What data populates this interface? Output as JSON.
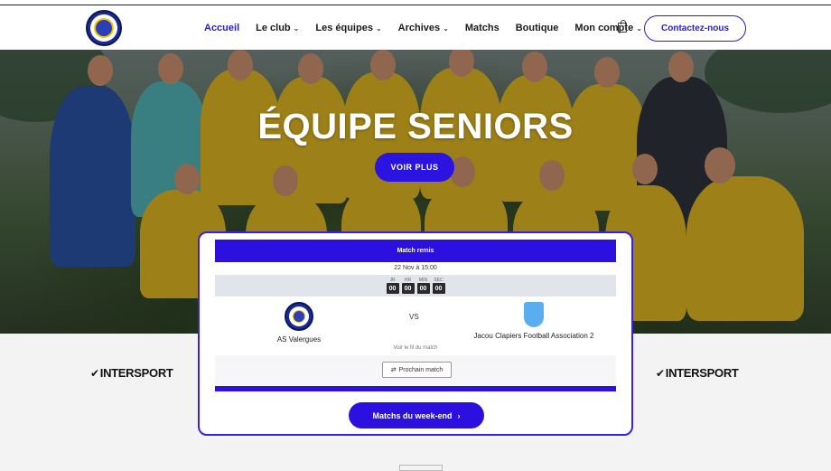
{
  "header": {
    "logo_name": "club-crest-logo",
    "nav": [
      {
        "label": "Accueil",
        "active": true,
        "dropdown": false
      },
      {
        "label": "Le club",
        "active": false,
        "dropdown": true
      },
      {
        "label": "Les équipes",
        "active": false,
        "dropdown": true
      },
      {
        "label": "Archives",
        "active": false,
        "dropdown": true
      },
      {
        "label": "Matchs",
        "active": false,
        "dropdown": false
      },
      {
        "label": "Boutique",
        "active": false,
        "dropdown": false
      },
      {
        "label": "Mon compte",
        "active": false,
        "dropdown": true
      }
    ],
    "cart_icon": "shopping-bag-icon",
    "contact_label": "Contactez-nous"
  },
  "hero": {
    "title": "ÉQUIPE SENIORS",
    "button_label": "VOIR PLUS"
  },
  "sponsors": {
    "left": "INTERSPORT",
    "right": "INTERSPORT"
  },
  "match_card": {
    "status": "Match remis",
    "datetime": "22 Nov à 15:00",
    "countdown": [
      {
        "label": "JR",
        "value": "00"
      },
      {
        "label": "HR",
        "value": "00"
      },
      {
        "label": "MIN",
        "value": "00"
      },
      {
        "label": "SEC",
        "value": "00"
      }
    ],
    "home_team": "AS Valergues",
    "vs": "VS",
    "away_team": "Jacou Clapiers Football Association 2",
    "thread_link": "Voir le fil du match",
    "next_match_label": "Prochain match",
    "weekend_label": "Matchs du week-end"
  },
  "colors": {
    "accent": "#2b10e0",
    "nav_active": "#2b1bd8",
    "jersey_yellow": "#c9a41e",
    "away_badge": "#5aaef0"
  }
}
